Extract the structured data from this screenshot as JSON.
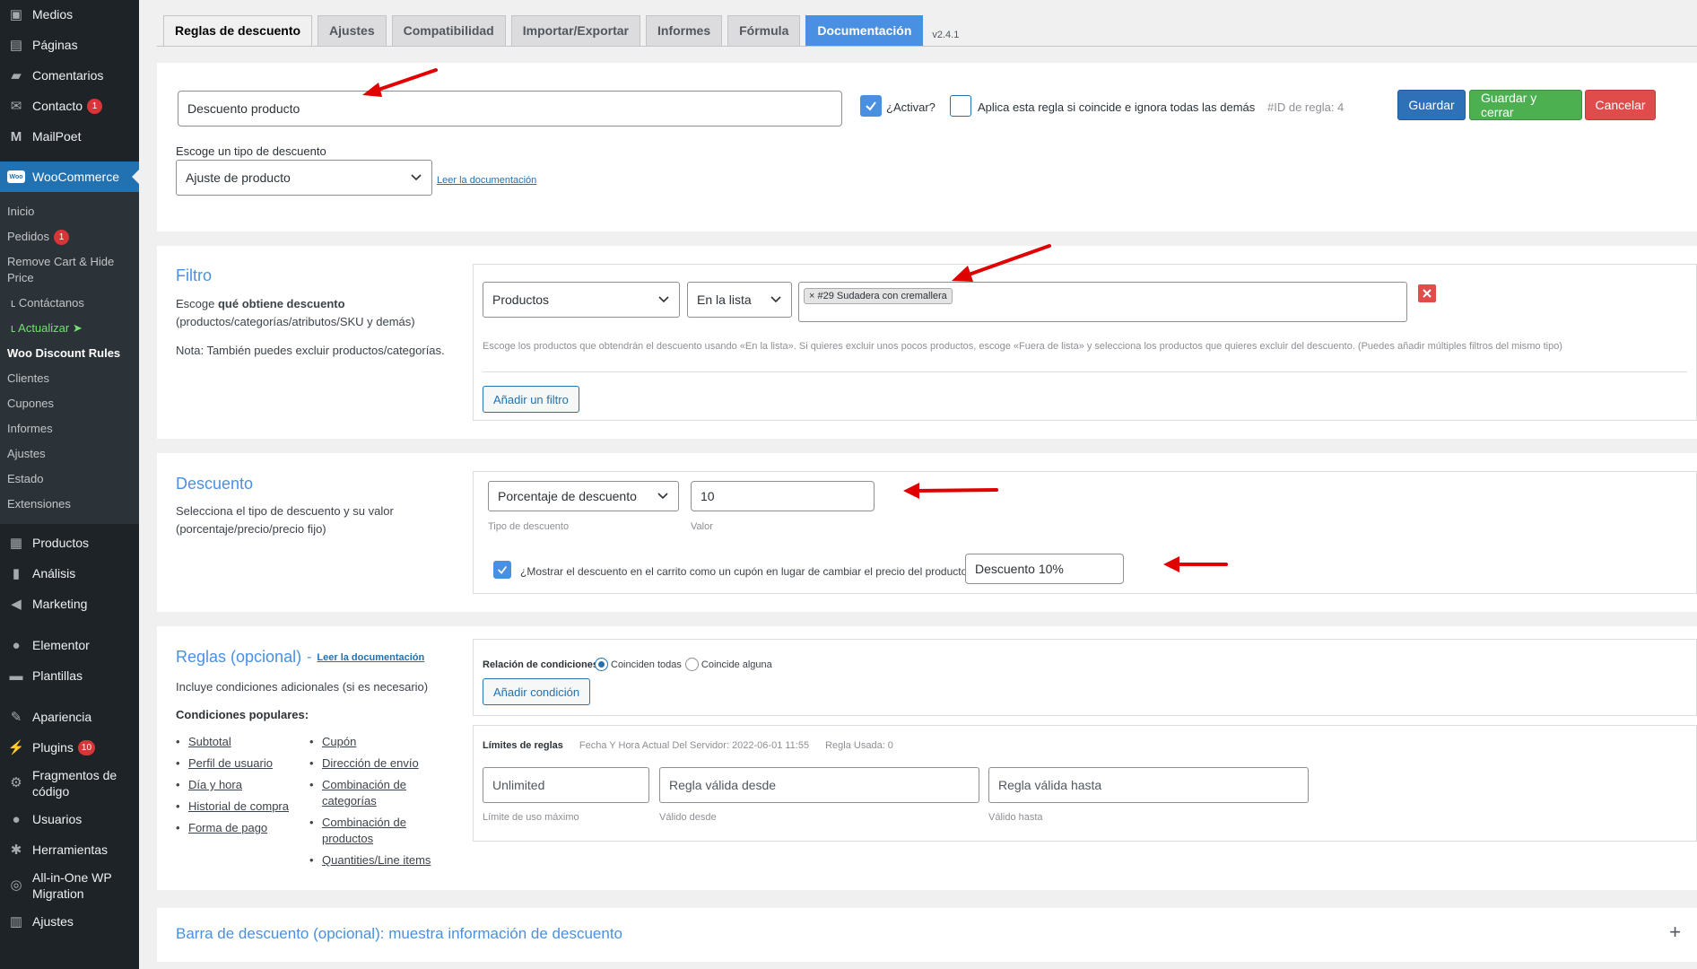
{
  "sidebar": {
    "top_items": [
      {
        "label": "Medios",
        "icon": "media-icon"
      },
      {
        "label": "Páginas",
        "icon": "pages-icon"
      },
      {
        "label": "Comentarios",
        "icon": "comments-icon"
      },
      {
        "label": "Contacto",
        "icon": "contact-icon",
        "badge": "1"
      },
      {
        "label": "MailPoet",
        "icon": "mailpoet-icon"
      }
    ],
    "woocommerce": {
      "label": "WooCommerce",
      "logo": "Woo"
    },
    "submenu": [
      {
        "label": "Inicio"
      },
      {
        "label": "Pedidos",
        "badge": "1"
      },
      {
        "label": "Remove Cart & Hide Price"
      },
      {
        "label": "ʟ Contáctanos"
      },
      {
        "label": "ʟ Actualizar ➤"
      },
      {
        "label": "Woo Discount Rules"
      },
      {
        "label": "Clientes"
      },
      {
        "label": "Cupones"
      },
      {
        "label": "Informes"
      },
      {
        "label": "Ajustes"
      },
      {
        "label": "Estado"
      },
      {
        "label": "Extensiones"
      }
    ],
    "bottom_items": [
      {
        "label": "Productos",
        "icon": "products-icon"
      },
      {
        "label": "Análisis",
        "icon": "analytics-icon"
      },
      {
        "label": "Marketing",
        "icon": "marketing-icon"
      },
      {
        "label": "Elementor",
        "icon": "elementor-icon"
      },
      {
        "label": "Plantillas",
        "icon": "templates-icon"
      },
      {
        "label": "Apariencia",
        "icon": "appearance-icon"
      },
      {
        "label": "Plugins",
        "icon": "plugins-icon",
        "badge": "10"
      },
      {
        "label": "Fragmentos de código",
        "icon": "snippets-icon"
      },
      {
        "label": "Usuarios",
        "icon": "users-icon"
      },
      {
        "label": "Herramientas",
        "icon": "tools-icon"
      },
      {
        "label": "All-in-One WP Migration",
        "icon": "migration-icon"
      },
      {
        "label": "Ajustes",
        "icon": "settings-icon"
      }
    ]
  },
  "tabs": [
    {
      "label": "Reglas de descuento",
      "active": true
    },
    {
      "label": "Ajustes"
    },
    {
      "label": "Compatibilidad"
    },
    {
      "label": "Importar/Exportar"
    },
    {
      "label": "Informes"
    },
    {
      "label": "Fórmula"
    },
    {
      "label": "Documentación",
      "doc": true
    }
  ],
  "version": "v2.4.1",
  "rule": {
    "name_value": "Descuento producto",
    "activate_label": "¿Activar?",
    "exclusive_label": "Aplica esta regla si coincide e ignora todas las demás",
    "rule_id": "#ID de regla: 4",
    "save_label": "Guardar",
    "save_close_label": "Guardar y cerrar",
    "cancel_label": "Cancelar",
    "type_label": "Escoge un tipo de descuento",
    "type_value": "Ajuste de producto",
    "doc_link": "Leer la documentación"
  },
  "filter": {
    "title": "Filtro",
    "desc_prefix": "Escoge ",
    "desc_bold": "qué obtiene descuento",
    "desc_suffix": "(productos/categorías/atributos/SKU y demás)",
    "note": "Nota: También puedes excluir productos/categorías.",
    "type_value": "Productos",
    "operator_value": "En la lista",
    "tag": "× #29 Sudadera con cremallera",
    "help": "Escoge los productos que obtendrán el descuento usando «En la lista». Si quieres excluir unos pocos productos, escoge «Fuera de lista» y selecciona los productos que quieres excluir del descuento. (Puedes añadir múltiples filtros del mismo tipo)",
    "add_label": "Añadir un filtro"
  },
  "discount": {
    "title": "Descuento",
    "desc1": "Selecciona el tipo de descuento y su valor",
    "desc2": "(porcentaje/precio/precio fijo)",
    "type_value": "Porcentaje de descuento",
    "type_caption": "Tipo de descuento",
    "value": "10",
    "value_caption": "Valor",
    "coupon_label": "¿Mostrar el descuento en el carrito como un cupón en lugar de cambiar el precio del producto?",
    "coupon_value": "Descuento 10%"
  },
  "rules": {
    "title": "Reglas (opcional)",
    "dash": "-",
    "doc_link": "Leer la documentación",
    "desc": "Incluye condiciones adicionales (si es necesario)",
    "popular_label": "Condiciones populares:",
    "col1": [
      "Subtotal",
      "Perfil de usuario",
      "Día y hora",
      "Historial de compra",
      "Forma de pago"
    ],
    "col2": [
      "Cupón",
      "Dirección de envío",
      "Combinación de categorías",
      "Combinación de productos",
      "Quantities/Line items"
    ],
    "relation_label": "Relación de condiciones",
    "match_all": "Coinciden todas",
    "match_any": "Coincide alguna",
    "add_condition": "Añadir condición",
    "limits_label": "Límites de reglas",
    "server_time": "Fecha Y Hora Actual Del Servidor: 2022-06-01 11:55",
    "rule_used": "Regla Usada: 0",
    "max_use_value": "Unlimited",
    "max_use_caption": "Límite de uso máximo",
    "valid_from_placeholder": "Regla válida desde",
    "valid_from_caption": "Válido desde",
    "valid_to_placeholder": "Regla válida hasta",
    "valid_to_caption": "Válido hasta"
  },
  "bar": {
    "title": "Barra de descuento (opcional): muestra información de descuento",
    "expand": "+"
  },
  "colors": {
    "accent": "#4a90e2",
    "arrow": "#e00000",
    "sidebar": "#1d2327",
    "wp_blue": "#2271b1"
  }
}
